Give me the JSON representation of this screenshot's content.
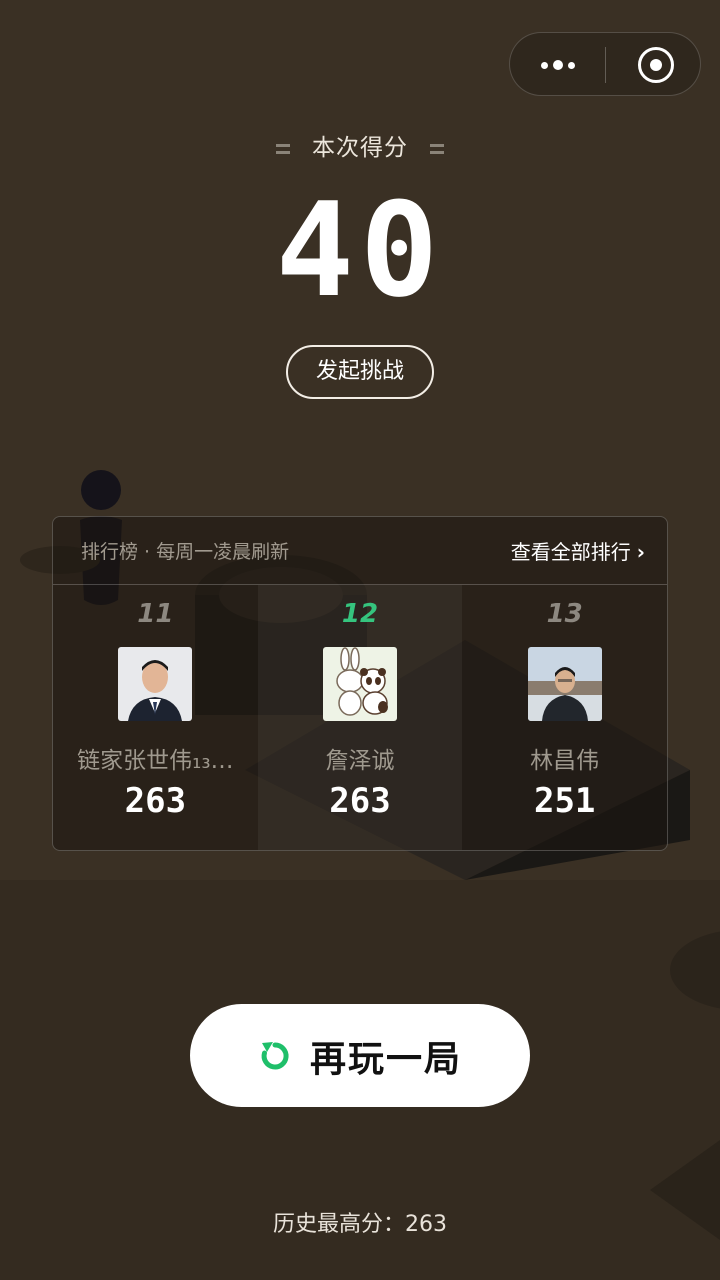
{
  "header": {
    "score_label": "本次得分",
    "score_value": "40"
  },
  "challenge_button": "发起挑战",
  "leaderboard": {
    "title": "排行榜 · 每周一凌晨刷新",
    "view_all": "查看全部排行",
    "players": [
      {
        "rank": "11",
        "name": "链家张世伟₁₃…",
        "score": "263",
        "highlight": false,
        "avatar": "person-suit-photo"
      },
      {
        "rank": "12",
        "name": "詹泽诚",
        "score": "263",
        "highlight": true,
        "avatar": "rabbit-panda-drawing"
      },
      {
        "rank": "13",
        "name": "林昌伟",
        "score": "251",
        "highlight": false,
        "avatar": "person-outdoor-photo"
      }
    ]
  },
  "replay_button": "再玩一局",
  "best_score": {
    "text": "历史最高分：263"
  },
  "colors": {
    "background": "#3a3024",
    "accent": "#35c47e",
    "button_bg": "#ffffff"
  },
  "icons": {
    "menu": "more-dots-icon",
    "close": "target-circle-icon",
    "replay": "refresh-icon",
    "chevron": "chevron-right-icon"
  }
}
